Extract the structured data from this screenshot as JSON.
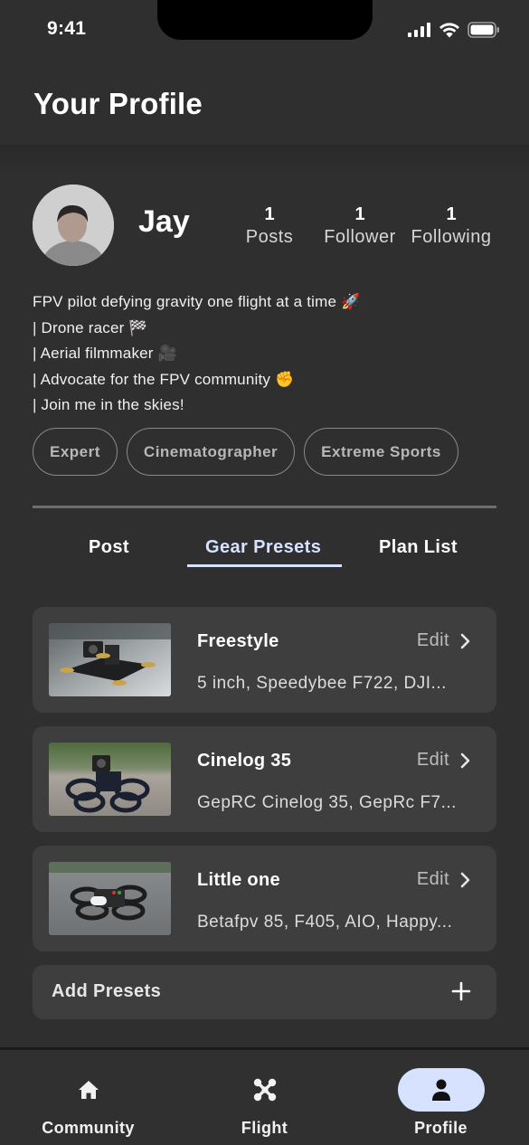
{
  "status_bar": {
    "time": "9:41"
  },
  "header": {
    "title": "Your Profile"
  },
  "profile": {
    "name": "Jay",
    "stats": [
      {
        "value": "1",
        "label": "Posts"
      },
      {
        "value": "1",
        "label": "Follower"
      },
      {
        "value": "1",
        "label": "Following"
      }
    ],
    "bio": [
      "FPV pilot defying gravity one flight at a time 🚀",
      "| Drone racer 🏁",
      "| Aerial filmmaker 🎥",
      "| Advocate for the FPV community ✊",
      "| Join me in the skies!"
    ],
    "tags": [
      "Expert",
      "Cinematographer",
      "Extreme Sports"
    ]
  },
  "tabs": [
    {
      "label": "Post",
      "active": false
    },
    {
      "label": "Gear Presets",
      "active": true
    },
    {
      "label": "Plan List",
      "active": false
    }
  ],
  "presets": [
    {
      "title": "Freestyle",
      "edit_label": "Edit",
      "description": "5 inch, Speedybee F722, DJI...",
      "thumb": "freestyle-drone-photo"
    },
    {
      "title": "Cinelog 35",
      "edit_label": "Edit",
      "description": "GepRC Cinelog 35, GepRc F7...",
      "thumb": "cinelog-drone-photo"
    },
    {
      "title": "Little one",
      "edit_label": "Edit",
      "description": "Betafpv 85, F405, AIO, Happy...",
      "thumb": "little-one-drone-photo"
    }
  ],
  "add_presets": {
    "label": "Add Presets",
    "icon": "plus-icon"
  },
  "nav": [
    {
      "label": "Community",
      "icon": "home-icon",
      "active": false
    },
    {
      "label": "Flight",
      "icon": "drone-icon",
      "active": false
    },
    {
      "label": "Profile",
      "icon": "person-icon",
      "active": true
    }
  ],
  "colors": {
    "background": "#2f2f2f",
    "card": "#3e3e3e",
    "accent": "#d6e2ff"
  }
}
